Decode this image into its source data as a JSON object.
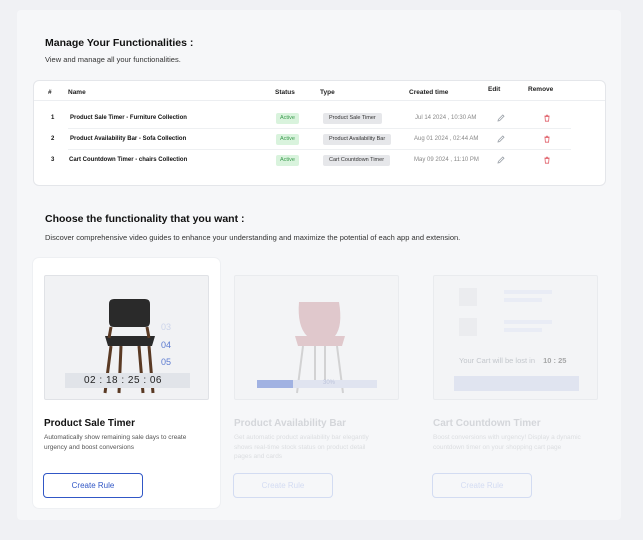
{
  "functionalities": {
    "title": "Manage Your Functionalities :",
    "subtitle": "View and manage all your functionalities.",
    "columns": {
      "num": "#",
      "name": "Name",
      "status": "Status",
      "type": "Type",
      "created": "Created time",
      "edit": "Edit",
      "remove": "Remove"
    },
    "rows": [
      {
        "num": "1",
        "name": "Product Sale Timer - Furniture Collection",
        "status": "Active",
        "type": "Product Sale Timer",
        "created": "Jul 14 2024 , 10:30 AM"
      },
      {
        "num": "2",
        "name": "Product Availability Bar - Sofa Collection",
        "status": "Active",
        "type": "Product Availability Bar",
        "created": "Aug 01 2024 , 02:44 AM"
      },
      {
        "num": "3",
        "name": "Cart Countdown Timer - chairs Collection",
        "status": "Active",
        "type": "Cart Countdown Timer",
        "created": "May 09 2024 , 11:10 PM"
      }
    ]
  },
  "choose": {
    "title": "Choose the functionality that you want :",
    "subtitle": "Discover comprehensive video guides to enhance your understanding and maximize the potential of each app and extension."
  },
  "cards": [
    {
      "title": "Product Sale Timer",
      "desc": "Automatically show remaining sale days to create urgency and boost conversions",
      "button": "Create Rule",
      "preview": {
        "timer": "02 : 18 : 25 : 06",
        "roll": [
          "03",
          "04",
          "05",
          "06"
        ]
      }
    },
    {
      "title": "Product Availability Bar",
      "desc": "Get automatic product availability bar elegantly shows real-time stock status on product detail pages and cards",
      "button": "Create Rule",
      "preview": {
        "bar_label": "30%",
        "bar_fill": 0.3
      }
    },
    {
      "title": "Cart Countdown Timer",
      "desc": "Boost conversions with urgency! Display a dynamic countdown timer on your shopping cart page",
      "button": "Create Rule",
      "preview": {
        "text": "Your Cart will be lost in",
        "time": "10 : 25"
      }
    }
  ],
  "colors": {
    "accent": "#3157c6",
    "active_bg": "#d9f3dd",
    "active_text": "#3a9b4d",
    "delete": "#e0606a"
  }
}
